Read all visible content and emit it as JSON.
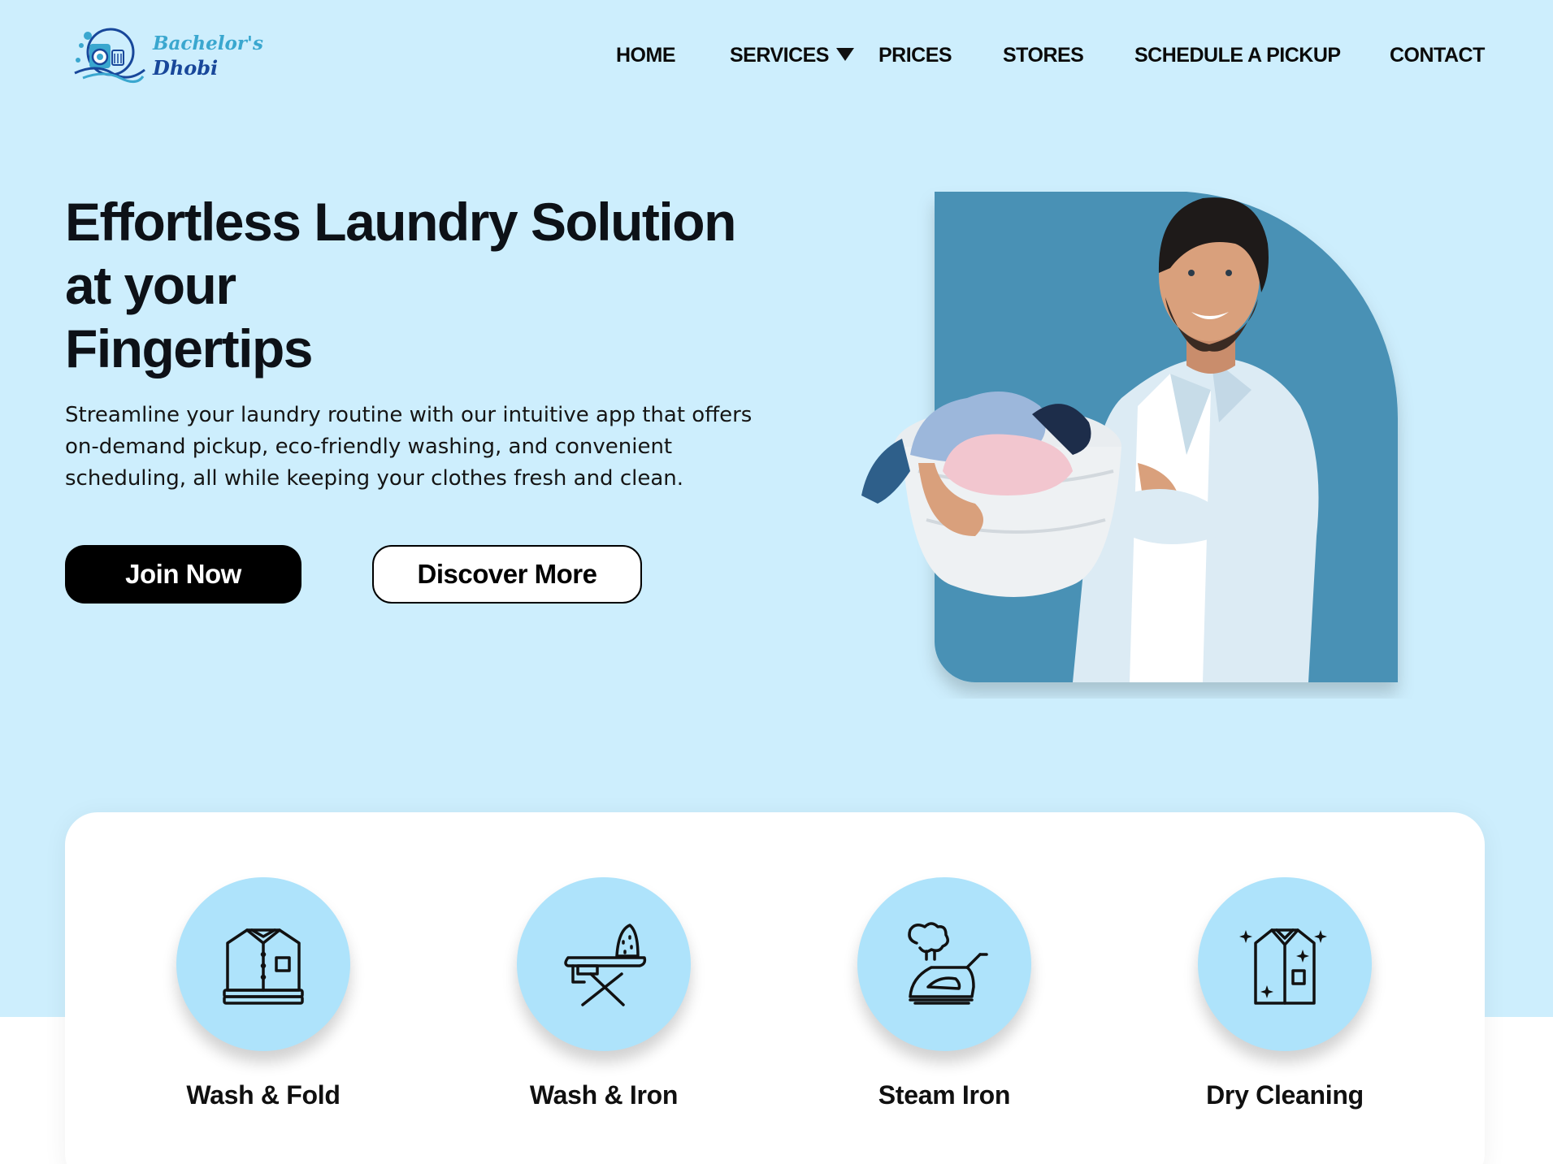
{
  "brand": {
    "name_line1": "Bachelor's",
    "name_line2": "Dhobi",
    "logo_icon": "washing-machine-logo-icon",
    "colors": {
      "light": "#3aa7cf",
      "dark": "#18479a"
    }
  },
  "nav": {
    "items": [
      {
        "label": "HOME"
      },
      {
        "label": "SERVICES",
        "has_dropdown": true,
        "icon": "caret-down-icon"
      },
      {
        "label": "PRICES"
      },
      {
        "label": "STORES"
      },
      {
        "label": "SCHEDULE A PICKUP"
      },
      {
        "label": "CONTACT"
      }
    ]
  },
  "hero": {
    "title_line1": "Effortless Laundry Solution",
    "title_line2": "at your",
    "title_line3": "Fingertips",
    "description": "Streamline your laundry routine with our intuitive app that offers on-demand pickup, eco-friendly washing, and convenient scheduling, all while keeping your clothes fresh and clean.",
    "primary_button": "Join Now",
    "secondary_button": "Discover More",
    "image": "man-holding-laundry-basket-photo"
  },
  "services": [
    {
      "label": "Wash & Fold",
      "icon": "folded-shirts-icon"
    },
    {
      "label": "Wash & Iron",
      "icon": "ironing-board-icon"
    },
    {
      "label": "Steam Iron",
      "icon": "steam-iron-icon"
    },
    {
      "label": "Dry Cleaning",
      "icon": "clean-shirt-icon"
    }
  ],
  "colors": {
    "hero_background": "#cdeefd",
    "photo_panel": "#4891b5",
    "service_circle": "#aee3fb",
    "primary_button": "#000000"
  }
}
